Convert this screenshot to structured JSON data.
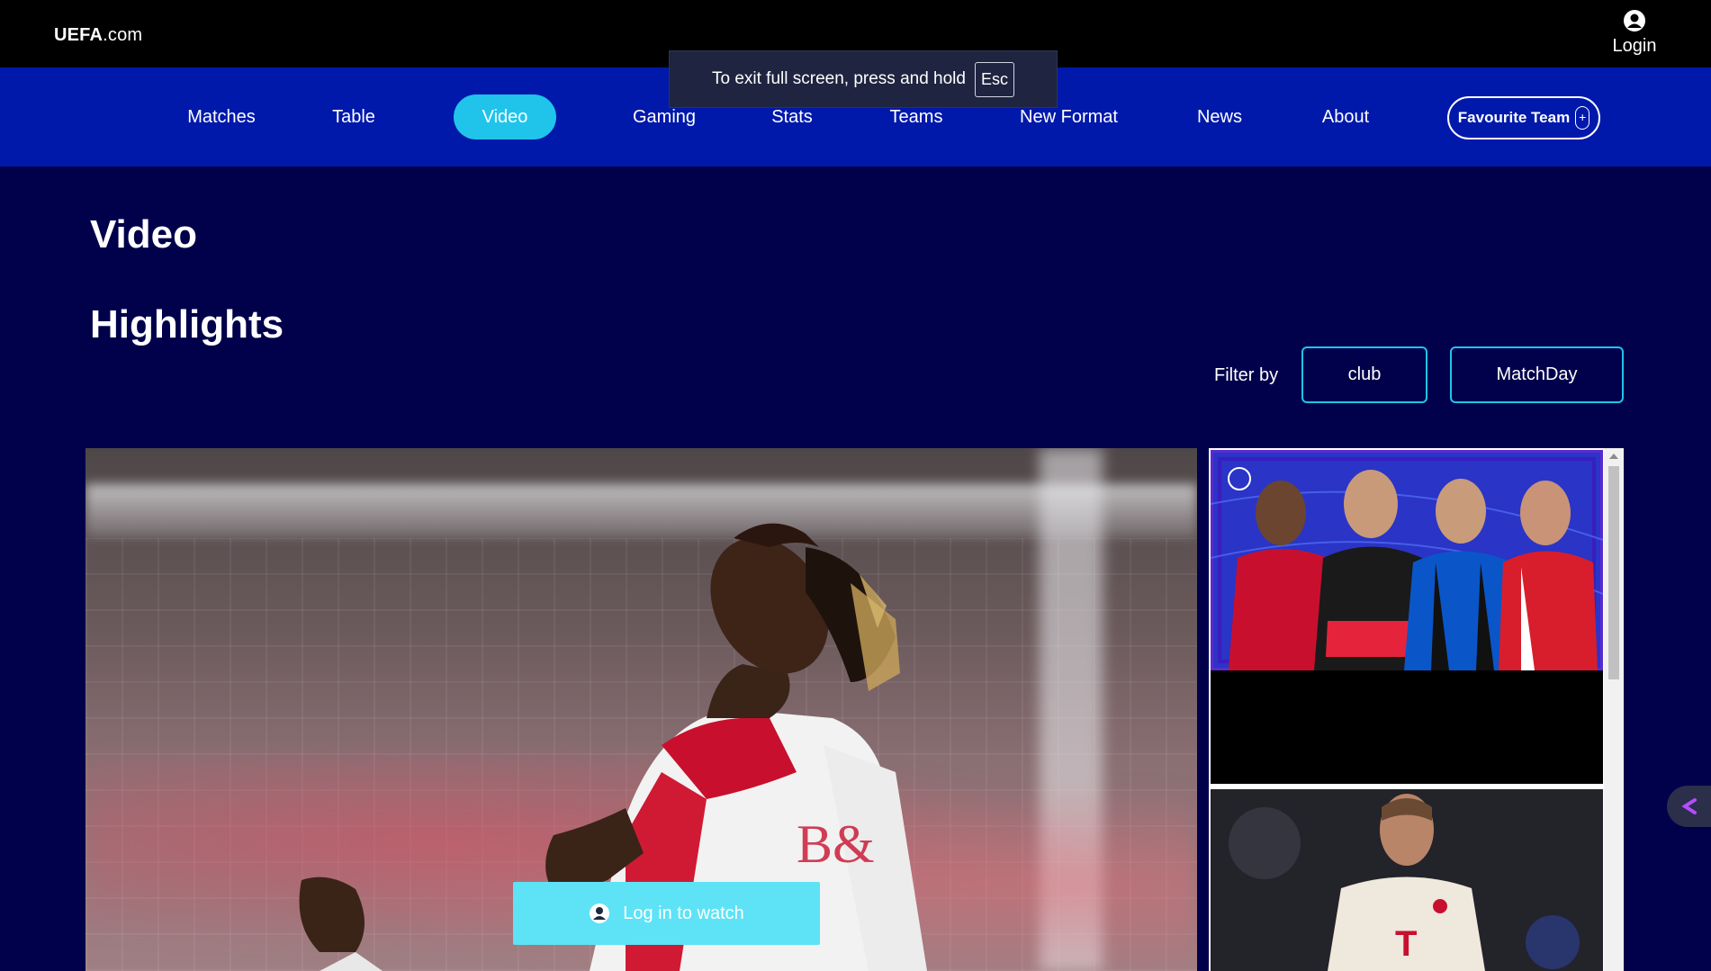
{
  "header": {
    "logo_bold": "UEFA",
    "logo_rest": ".com",
    "login_label": "Login"
  },
  "fullscreen_notice": {
    "text": "To exit full screen, press and hold",
    "key": "Esc"
  },
  "nav": {
    "items": [
      {
        "label": "Matches",
        "active": false
      },
      {
        "label": "Table",
        "active": false
      },
      {
        "label": "Video",
        "active": true
      },
      {
        "label": "Gaming",
        "active": false
      },
      {
        "label": "Stats",
        "active": false
      },
      {
        "label": "Teams",
        "active": false
      },
      {
        "label": "New Format",
        "active": false
      },
      {
        "label": "News",
        "active": false
      },
      {
        "label": "About",
        "active": false
      }
    ],
    "favourite_label": "Favourite Team",
    "favourite_icon": "plus-icon"
  },
  "main": {
    "page_title": "Video",
    "section_title": "Highlights",
    "filter_label": "Filter by",
    "filters": [
      "club",
      "MatchDay"
    ],
    "hero": {
      "watch_label": "Log in to watch",
      "watch_icon": "user-icon"
    }
  },
  "colors": {
    "top_bar": "#000000",
    "nav_bar": "#0019ab",
    "page_bg": "#00004b",
    "accent_cyan": "#20c4ea",
    "watch_button": "#5de3f5"
  }
}
